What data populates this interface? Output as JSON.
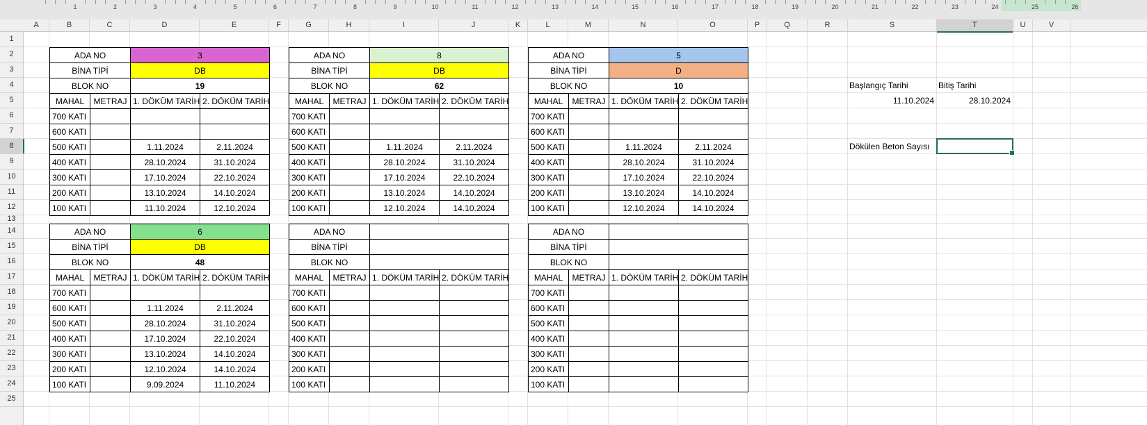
{
  "ruler": {
    "numbers": [
      "1",
      "2",
      "3",
      "4",
      "5",
      "6",
      "7",
      "8",
      "9",
      "10",
      "11",
      "12",
      "13",
      "14",
      "15",
      "16",
      "17",
      "18",
      "19",
      "20",
      "21",
      "22",
      "23",
      "24",
      "25",
      "26"
    ]
  },
  "columns": {
    "letters": [
      "A",
      "B",
      "C",
      "D",
      "E",
      "F",
      "G",
      "H",
      "I",
      "J",
      "K",
      "L",
      "M",
      "N",
      "O",
      "P",
      "Q",
      "R",
      "S",
      "T",
      "U",
      "V"
    ],
    "selected": "T"
  },
  "rows": {
    "numbers": [
      "1",
      "2",
      "3",
      "4",
      "5",
      "6",
      "7",
      "8",
      "9",
      "10",
      "11",
      "12",
      "13",
      "14",
      "15",
      "16",
      "17",
      "18",
      "19",
      "20",
      "21",
      "22",
      "23",
      "24",
      "25"
    ],
    "selected": "8"
  },
  "labels": {
    "ada_no": "ADA NO",
    "bina_tipi": "BİNA TİPİ",
    "blok_no": "BLOK NO",
    "mahal": "MAHAL",
    "metraj": "METRAJ",
    "dokum1": "1. DÖKÜM TARİH",
    "dokum2": "2. DÖKÜM TARİH",
    "floors": [
      "700 KATI",
      "600 KATI",
      "500 KATI",
      "400 KATI",
      "300 KATI",
      "200 KATI",
      "100 KATI"
    ]
  },
  "colors": {
    "magenta": "#d966d0",
    "light_green": "#d9f2d0",
    "light_blue": "#a4c6ec",
    "yellow": "#ffff00",
    "orange": "#f4b084",
    "green": "#84e08e",
    "selection": "#217346"
  },
  "blocks": [
    {
      "ada": "3",
      "bina": "DB",
      "blok": "19",
      "dates": [
        [
          "",
          ""
        ],
        [
          "",
          ""
        ],
        [
          "1.11.2024",
          "2.11.2024"
        ],
        [
          "28.10.2024",
          "31.10.2024"
        ],
        [
          "17.10.2024",
          "22.10.2024"
        ],
        [
          "13.10.2024",
          "14.10.2024"
        ],
        [
          "11.10.2024",
          "12.10.2024"
        ]
      ]
    },
    {
      "ada": "8",
      "bina": "DB",
      "blok": "62",
      "dates": [
        [
          "",
          ""
        ],
        [
          "",
          ""
        ],
        [
          "1.11.2024",
          "2.11.2024"
        ],
        [
          "28.10.2024",
          "31.10.2024"
        ],
        [
          "17.10.2024",
          "22.10.2024"
        ],
        [
          "13.10.2024",
          "14.10.2024"
        ],
        [
          "12.10.2024",
          "14.10.2024"
        ]
      ]
    },
    {
      "ada": "5",
      "bina": "D",
      "blok": "10",
      "dates": [
        [
          "",
          ""
        ],
        [
          "",
          ""
        ],
        [
          "1.11.2024",
          "2.11.2024"
        ],
        [
          "28.10.2024",
          "31.10.2024"
        ],
        [
          "17.10.2024",
          "22.10.2024"
        ],
        [
          "13.10.2024",
          "14.10.2024"
        ],
        [
          "12.10.2024",
          "14.10.2024"
        ]
      ]
    },
    {
      "ada": "6",
      "bina": "DB",
      "blok": "48",
      "dates": [
        [
          "",
          ""
        ],
        [
          "1.11.2024",
          "2.11.2024"
        ],
        [
          "28.10.2024",
          "31.10.2024"
        ],
        [
          "17.10.2024",
          "22.10.2024"
        ],
        [
          "13.10.2024",
          "14.10.2024"
        ],
        [
          "12.10.2024",
          "14.10.2024"
        ],
        [
          "9.09.2024",
          "11.10.2024"
        ]
      ]
    },
    {
      "ada": "",
      "bina": "",
      "blok": "",
      "dates": [
        [
          "",
          ""
        ],
        [
          "",
          ""
        ],
        [
          "",
          ""
        ],
        [
          "",
          ""
        ],
        [
          "",
          ""
        ],
        [
          "",
          ""
        ],
        [
          "",
          ""
        ]
      ]
    },
    {
      "ada": "",
      "bina": "",
      "blok": "",
      "dates": [
        [
          "",
          ""
        ],
        [
          "",
          ""
        ],
        [
          "",
          ""
        ],
        [
          "",
          ""
        ],
        [
          "",
          ""
        ],
        [
          "",
          ""
        ],
        [
          "",
          ""
        ]
      ]
    }
  ],
  "side": {
    "start_label": "Başlangıç Tarihi",
    "end_label": "Bitiş Tarihi",
    "start_value": "11.10.2024",
    "end_value": "28.10.2024",
    "count_label": "Dökülen Beton Sayısı",
    "count_value": ""
  }
}
